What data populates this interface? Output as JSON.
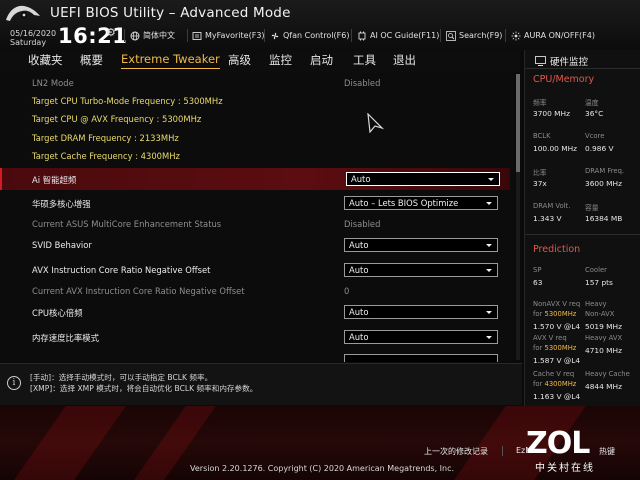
{
  "header": {
    "title": "UEFI BIOS Utility – Advanced Mode",
    "date": "05/16/2020",
    "day": "Saturday",
    "time": "16:21",
    "items": [
      {
        "icon": "globe-icon",
        "label": "简体中文"
      },
      {
        "icon": "favorite-icon",
        "label": "MyFavorite(F3)"
      },
      {
        "icon": "fan-icon",
        "label": "Qfan Control(F6)"
      },
      {
        "icon": "ai-oc-icon",
        "label": "AI OC Guide(F11)"
      },
      {
        "icon": "search-icon",
        "label": "Search(F9)"
      },
      {
        "icon": "aura-icon",
        "label": "AURA ON/OFF(F4)"
      }
    ]
  },
  "tabs": [
    "收藏夹",
    "概要",
    "Extreme Tweaker",
    "高级",
    "监控",
    "启动",
    "工具",
    "退出"
  ],
  "active_tab": "Extreme Tweaker",
  "settings": [
    {
      "label": "LN2 Mode",
      "value": "Disabled",
      "type": "static-dim"
    },
    {
      "label": "Target CPU Turbo-Mode Frequency : 5300MHz",
      "type": "info"
    },
    {
      "label": "Target CPU @ AVX Frequency : 5300MHz",
      "type": "info"
    },
    {
      "label": "Target DRAM Frequency : 2133MHz",
      "type": "info"
    },
    {
      "label": "Target Cache Frequency : 4300MHz",
      "type": "info"
    },
    {
      "label": "Ai 智能超频",
      "value": "Auto",
      "type": "dropdown",
      "selected": true
    },
    {
      "label": "华硕多核心增强",
      "value": "Auto – Lets BIOS Optimize",
      "type": "dropdown"
    },
    {
      "label": "Current ASUS MultiCore Enhancement Status",
      "value": "Disabled",
      "type": "static-dim"
    },
    {
      "label": "SVID Behavior",
      "value": "Auto",
      "type": "dropdown"
    },
    {
      "label": "AVX Instruction Core Ratio Negative Offset",
      "value": "Auto",
      "type": "dropdown"
    },
    {
      "label": "Current AVX Instruction Core Ratio Negative Offset",
      "value": "0",
      "type": "static-dim"
    },
    {
      "label": "CPU核心倍频",
      "value": "Auto",
      "type": "dropdown"
    },
    {
      "label": "内存速度比率模式",
      "value": "Auto",
      "type": "dropdown"
    }
  ],
  "help": {
    "line1": "[手动]：选择手动模式时，可以手动指定 BCLK 频率。",
    "line2": "[XMP]：选择 XMP 模式时，将会自动优化 BCLK 频率和内存参数。"
  },
  "hw_monitor": {
    "title": "硬件监控",
    "cpu_section": "CPU/Memory",
    "cpu": [
      {
        "label": "频率",
        "value": "3700 MHz"
      },
      {
        "label": "温度",
        "value": "36°C"
      },
      {
        "label": "BCLK",
        "value": "100.00 MHz"
      },
      {
        "label": "Vcore",
        "value": "0.986 V"
      },
      {
        "label": "比率",
        "value": "37x"
      },
      {
        "label": "DRAM Freq.",
        "value": "3600 MHz"
      },
      {
        "label": "DRAM Volt.",
        "value": "1.343 V"
      },
      {
        "label": "容量",
        "value": "16384 MB"
      }
    ],
    "prediction_section": "Prediction",
    "sp_label": "SP",
    "sp_value": "63",
    "cooler_label": "Cooler",
    "cooler_value": "157 pts",
    "nonavx_label": "NonAVX V req",
    "nonavx_for": "for",
    "nonavx_freq": "5300MHz",
    "nonavx_value": "1.570 V @L4",
    "heavy_nonavx_label": "Heavy",
    "heavy_nonavx_label2": "Non-AVX",
    "heavy_nonavx_value": "5019 MHz",
    "avx_label": "AVX V req",
    "avx_for": "for",
    "avx_freq": "5300MHz",
    "avx_value": "1.587 V @L4",
    "heavy_avx_label": "Heavy AVX",
    "heavy_avx_value": "4710 MHz",
    "cache_label": "Cache V req",
    "cache_for": "for",
    "cache_freq": "4300MHz",
    "cache_value": "1.163 V @L4",
    "heavy_cache_label": "Heavy Cache",
    "heavy_cache_value": "4844 MHz"
  },
  "footer": {
    "last_modified": "上一次的修改记录",
    "ez_mode": "EzM",
    "hotkeys": "热键",
    "version": "Version 2.20.1276. Copyright (C) 2020 American Megatrends, Inc.",
    "watermark_word": "ZOL",
    "watermark_sub": "中关村在线"
  },
  "colors": {
    "accent": "#f0b948",
    "info_text": "#eadb6a",
    "selected_row": "#5c0d11",
    "section_red": "#e0584a"
  }
}
